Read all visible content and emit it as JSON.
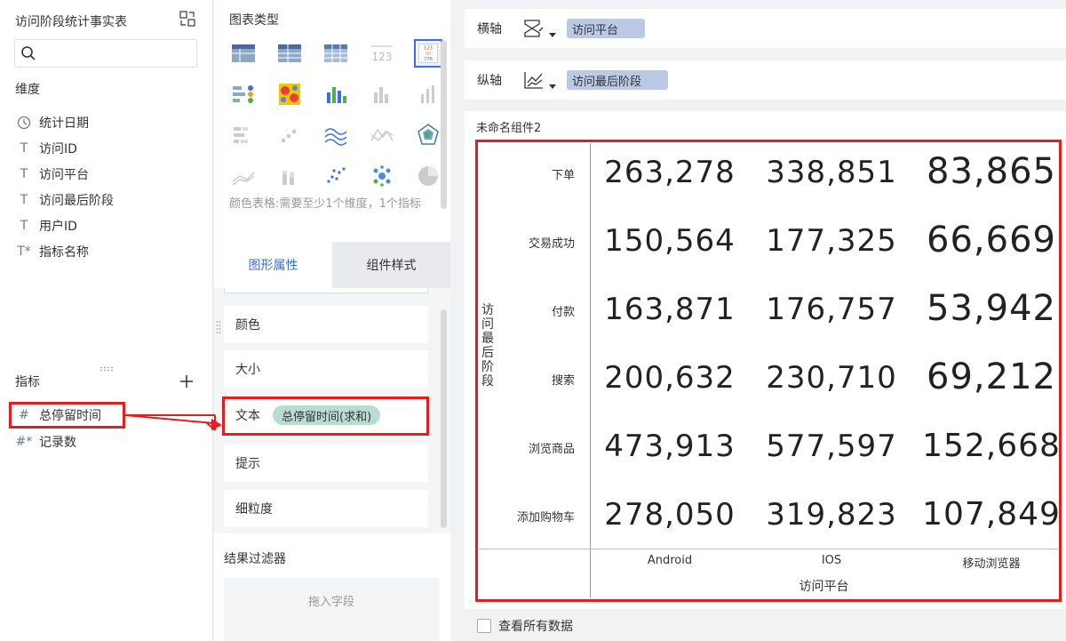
{
  "left": {
    "dataset_title": "访问阶段统计事实表",
    "dimension_section": "维度",
    "dimensions": [
      {
        "icon": "clock-icon",
        "symbol": "◷",
        "label": "统计日期"
      },
      {
        "icon": "text-type-icon",
        "symbol": "T",
        "label": "访问ID"
      },
      {
        "icon": "text-type-icon",
        "symbol": "T",
        "label": "访问平台"
      },
      {
        "icon": "text-type-icon",
        "symbol": "T",
        "label": "访问最后阶段"
      },
      {
        "icon": "text-type-icon",
        "symbol": "T",
        "label": "用户ID"
      },
      {
        "icon": "text-type-icon",
        "symbol": "T*",
        "label": "指标名称"
      }
    ],
    "measure_section": "指标",
    "measures": [
      {
        "icon": "number-type-icon",
        "symbol": "#",
        "label": "总停留时间"
      },
      {
        "icon": "number-type-icon",
        "symbol": "#*",
        "label": "记录数"
      }
    ]
  },
  "middle": {
    "chart_type_title": "图表类型",
    "chart_type_hint": "颜色表格:需要至少1个维度，1个指标",
    "tabs": {
      "graph_props": "图形属性",
      "component_style": "组件样式"
    },
    "partial_row_label": "文本",
    "props": {
      "color": "颜色",
      "size": "大小",
      "text": "文本",
      "text_field": "总停留时间(求和)",
      "tooltip": "提示",
      "granularity": "细粒度"
    },
    "result_filter_title": "结果过滤器",
    "drop_hint": "拖入字段"
  },
  "right": {
    "x_axis_label": "横轴",
    "x_axis_field": "访问平台",
    "y_axis_label": "纵轴",
    "y_axis_field": "访问最后阶段",
    "component_name": "未命名组件2",
    "show_all_data": "查看所有数据"
  },
  "colors": {
    "accent": "#3a6ee8",
    "highlight_red": "#e02020",
    "dimension_pill": "#b9c9e6",
    "measure_pill": "#b9dcd2"
  },
  "chart_data": {
    "type": "table",
    "row_axis_title": "访问最后阶段",
    "col_axis_title": "访问平台",
    "columns": [
      "Android",
      "IOS",
      "移动浏览器"
    ],
    "rows": [
      "下单",
      "交易成功",
      "付款",
      "搜索",
      "浏览商品",
      "添加购物车"
    ],
    "values": [
      [
        "263,278",
        "338,851",
        "83,865"
      ],
      [
        "150,564",
        "177,325",
        "66,669"
      ],
      [
        "163,871",
        "176,757",
        "53,942"
      ],
      [
        "200,632",
        "230,710",
        "69,212"
      ],
      [
        "473,913",
        "577,597",
        "152,668"
      ],
      [
        "278,050",
        "319,823",
        "107,849"
      ]
    ],
    "numeric_values": [
      [
        263278,
        338851,
        83865
      ],
      [
        150564,
        177325,
        66669
      ],
      [
        163871,
        176757,
        53942
      ],
      [
        200632,
        230710,
        69212
      ],
      [
        473913,
        577597,
        152668
      ],
      [
        278050,
        319823,
        107849
      ]
    ]
  }
}
